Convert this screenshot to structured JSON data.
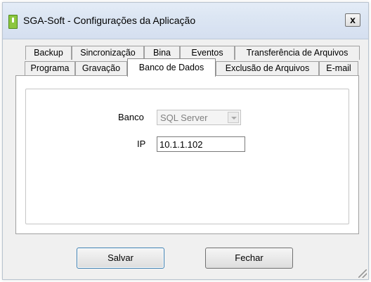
{
  "window": {
    "title": "SGA-Soft - Configurações da Aplicação",
    "close_glyph": "x"
  },
  "tabs": {
    "row1": [
      "Backup",
      "Sincronização",
      "Bina",
      "Eventos",
      "Transferência de Arquivos"
    ],
    "row2": [
      "Programa",
      "Gravação",
      "Banco de Dados",
      "Exclusão de Arquivos",
      "E-mail"
    ],
    "selected": "Banco de Dados"
  },
  "form": {
    "banco_label": "Banco",
    "banco_value": "SQL Server",
    "ip_label": "IP",
    "ip_value": "10.1.1.102"
  },
  "buttons": {
    "save": "Salvar",
    "close": "Fechar"
  },
  "icons": {
    "app": "app-icon",
    "close": "close-icon",
    "dropdown": "chevron-down-icon",
    "resize": "resize-grip-icon"
  },
  "colors": {
    "titlebar": "#dce6f3",
    "app_icon": "#8cc63f",
    "default_button_border": "#3c7fb1"
  }
}
